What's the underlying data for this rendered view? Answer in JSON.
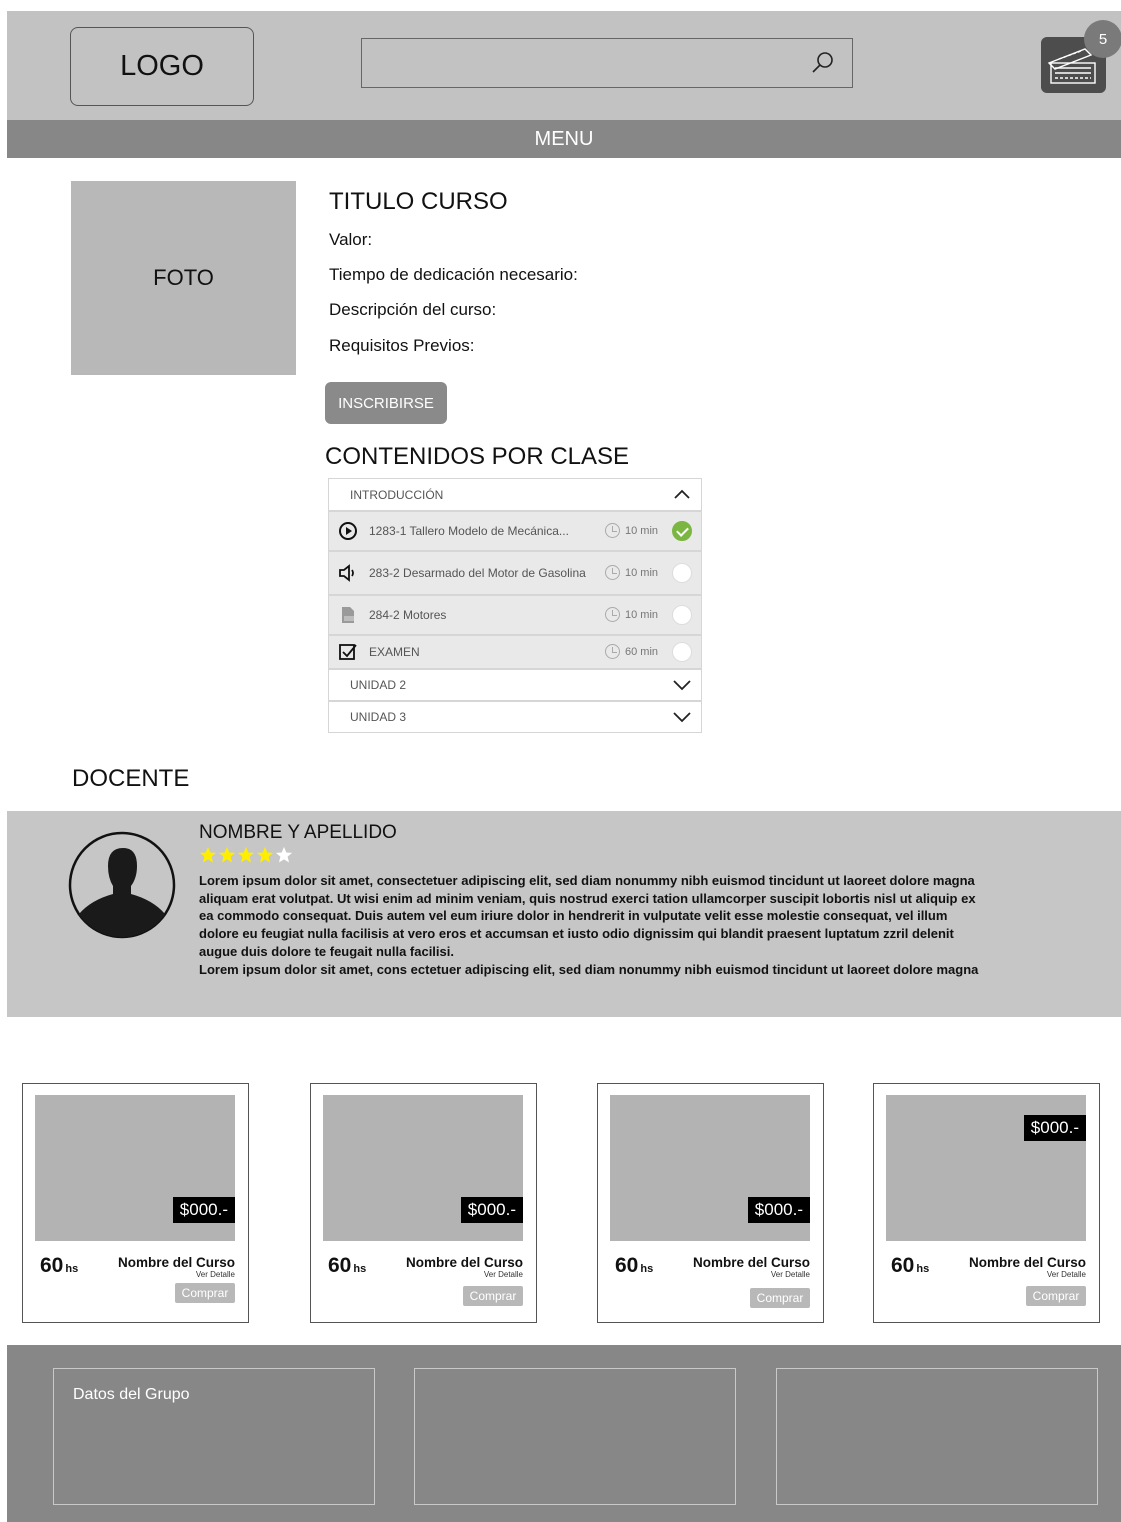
{
  "header": {
    "logo": "LOGO",
    "search": {
      "value": "",
      "placeholder": "",
      "icon": "search-icon"
    },
    "cart": {
      "icon": "cart-icon",
      "badge_count": "5"
    }
  },
  "menu": {
    "label": "MENU"
  },
  "course": {
    "photo_label": "FOTO",
    "title": "TITULO CURSO",
    "lines": [
      "Valor:",
      "Tiempo de dedicación necesario:",
      "Descripción del curso:",
      "Requisitos Previos:"
    ],
    "enroll_label": "INSCRIBIRSE"
  },
  "contents": {
    "title": "CONTENIDOS POR CLASE",
    "sections": [
      {
        "label": "INTRODUCCIÓN",
        "expanded": true,
        "items": [
          {
            "icon": "play-icon",
            "label": "1283-1 Tallero Modelo de Mecánica...",
            "time": "10 min",
            "completed": true
          },
          {
            "icon": "audio-icon",
            "label": "283-2 Desarmado del Motor de Gasolina",
            "time": "10 min",
            "completed": false
          },
          {
            "icon": "pdf-icon",
            "label": "284-2 Motores",
            "time": "10 min",
            "completed": false
          },
          {
            "icon": "exam-icon",
            "label": "EXAMEN",
            "time": "60 min",
            "completed": false
          }
        ]
      },
      {
        "label": "UNIDAD 2",
        "expanded": false
      },
      {
        "label": "UNIDAD 3",
        "expanded": false
      }
    ]
  },
  "teacher": {
    "section_title": "DOCENTE",
    "name": "NOMBRE Y APELLIDO",
    "rating": 4,
    "rating_max": 5,
    "bio_lines": [
      "Lorem ipsum dolor sit amet, consectetuer adipiscing elit, sed diam nonummy nibh euismod tincidunt ut laoreet dolore magna",
      "aliquam erat volutpat. Ut wisi enim ad minim veniam, quis nostrud exerci tation ullamcorper suscipit lobortis nisl ut aliquip ex",
      "ea commodo consequat. Duis autem vel eum iriure dolor in hendrerit in vulputate velit esse molestie consequat, vel illum",
      "dolore eu feugiat nulla facilisis at vero eros et accumsan et iusto odio dignissim qui blandit praesent luptatum zzril delenit",
      "augue duis dolore te feugait nulla facilisi.",
      "Lorem ipsum dolor sit amet, cons ectetuer adipiscing elit, sed diam nonummy nibh euismod tincidunt ut laoreet dolore magna"
    ]
  },
  "related_courses": [
    {
      "price": "$000.-",
      "hours": "60",
      "hours_unit": "hs",
      "name": "Nombre del Curso",
      "detail": "Ver Detalle",
      "buy": "Comprar"
    },
    {
      "price": "$000.-",
      "hours": "60",
      "hours_unit": "hs",
      "name": "Nombre del Curso",
      "detail": "Ver Detalle",
      "buy": "Comprar"
    },
    {
      "price": "$000.-",
      "hours": "60",
      "hours_unit": "hs",
      "name": "Nombre del Curso",
      "detail": "Ver Detalle",
      "buy": "Comprar"
    },
    {
      "price": "$000.-",
      "hours": "60",
      "hours_unit": "hs",
      "name": "Nombre del Curso",
      "detail": "Ver Detalle",
      "buy": "Comprar"
    }
  ],
  "footer": {
    "boxes": [
      "Datos del Grupo",
      "",
      ""
    ]
  },
  "colors": {
    "completed": "#7bb642",
    "star": "#ffee00",
    "header_bg": "#c2c2c2",
    "menu_bg": "#878787",
    "price_bg": "#000000"
  }
}
